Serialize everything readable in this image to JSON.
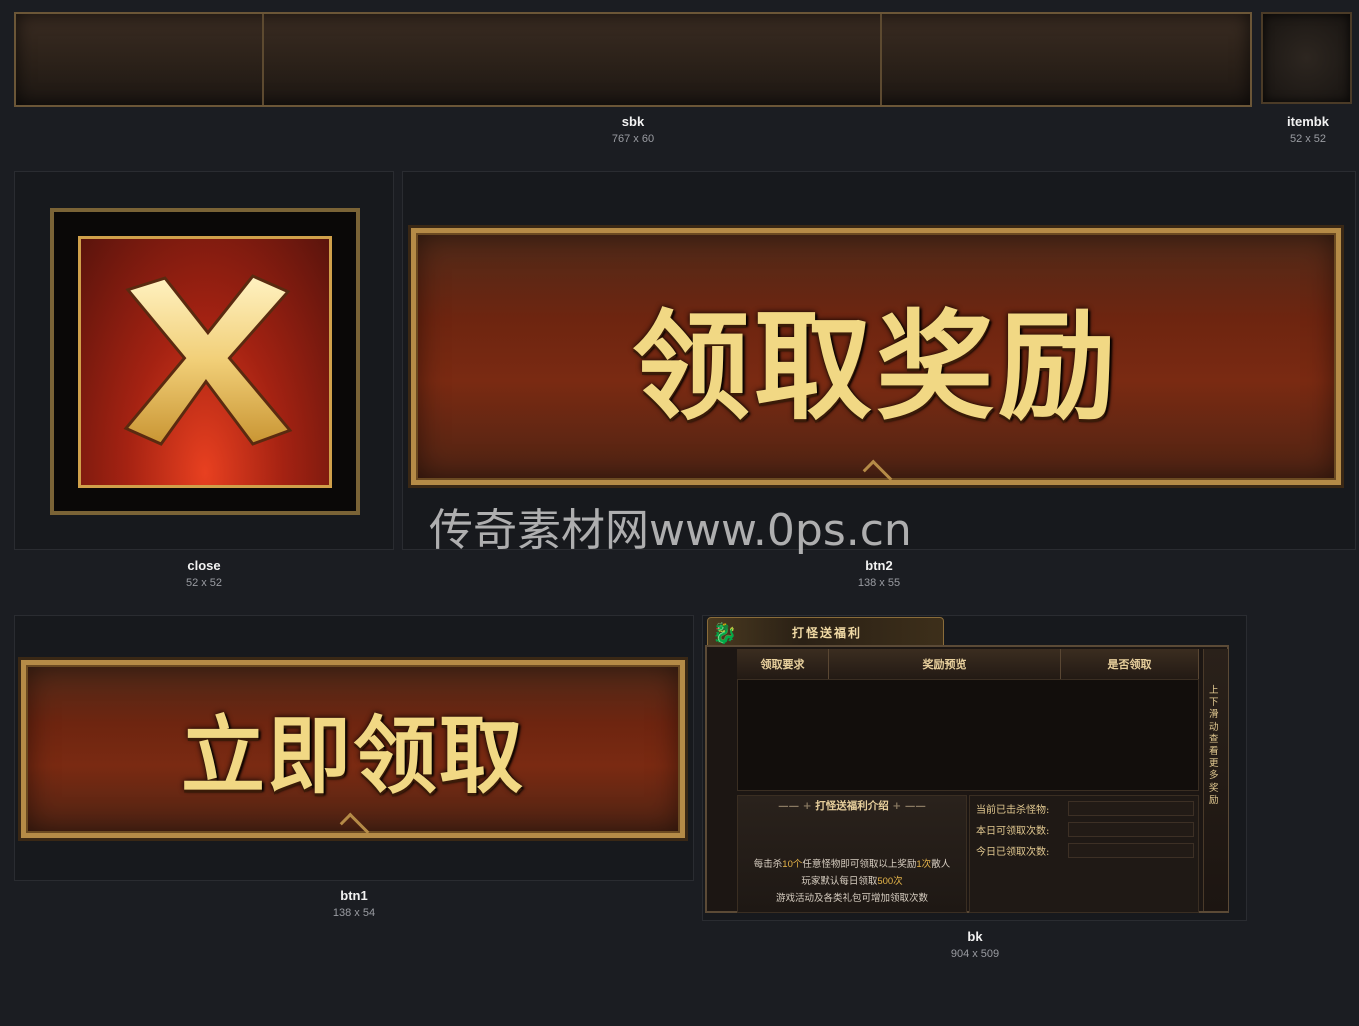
{
  "assets": {
    "sbk": {
      "name": "sbk",
      "size": "767 x 60"
    },
    "itembk": {
      "name": "itembk",
      "size": "52 x 52"
    },
    "close": {
      "name": "close",
      "size": "52 x 52"
    },
    "btn2": {
      "name": "btn2",
      "size": "138 x 55",
      "label": "领取奖励"
    },
    "btn1": {
      "name": "btn1",
      "size": "138 x 54",
      "label": "立即领取"
    },
    "bk": {
      "name": "bk",
      "size": "904 x 509"
    }
  },
  "watermark": "传奇素材网www.0ps.cn",
  "bk_panel": {
    "title": "打怪送福利",
    "columns": [
      "领取要求",
      "奖励预览",
      "是否领取"
    ],
    "side_hint": "上下滑动查看更多奖励",
    "intro_title": "打怪送福利介绍",
    "desc_line1_a": "每击杀",
    "desc_line1_b": "10个",
    "desc_line1_c": "任意怪物即可领取以上奖励",
    "desc_line1_d": "1次",
    "desc_line1_e": "散人",
    "desc_line2_a": "玩家默认每日领取",
    "desc_line2_b": "500次",
    "desc_line3": "游戏活动及各类礼包可增加领取次数",
    "stats": [
      "当前已击杀怪物:",
      "本日可领取次数:",
      "今日已领取次数:"
    ]
  },
  "colors": {
    "background": "#1b1d22",
    "gold": "#f1d884",
    "frame": "#b58b47",
    "red": "#7a2a12"
  }
}
